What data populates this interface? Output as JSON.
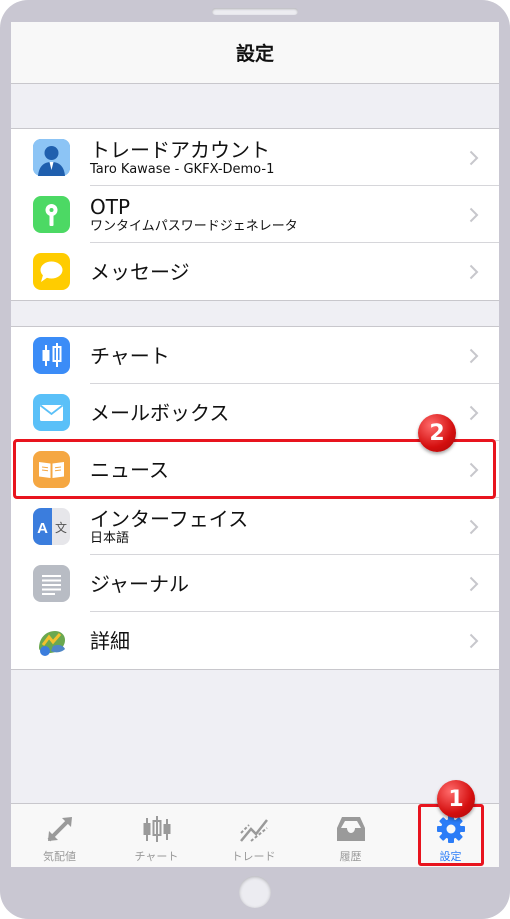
{
  "nav": {
    "title": "設定"
  },
  "groups": [
    {
      "items": [
        {
          "title": "トレードアカウント",
          "subtitle": "Taro Kawase - GKFX-Demo-1",
          "icon": "person-icon",
          "color": "#5ba8f0"
        },
        {
          "title": "OTP",
          "subtitle": "ワンタイムパスワードジェネレータ",
          "icon": "key-icon",
          "color": "#4cd964"
        },
        {
          "title": "メッセージ",
          "icon": "speech-bubble-icon",
          "color": "#ffcc00"
        }
      ]
    },
    {
      "items": [
        {
          "title": "チャート",
          "icon": "candlestick-icon",
          "color": "#3b8cf7"
        },
        {
          "title": "メールボックス",
          "icon": "envelope-icon",
          "color": "#5ac0f8"
        },
        {
          "title": "ニュース",
          "icon": "book-icon",
          "color": "#f5a742"
        },
        {
          "title": "インターフェイス",
          "subtitle": "日本語",
          "icon": "translate-icon",
          "color": "#3b7ddd"
        },
        {
          "title": "ジャーナル",
          "icon": "document-lines-icon",
          "color": "#b8bcc4"
        },
        {
          "title": "詳細",
          "icon": "metatrader-icon",
          "color": "#6aa84f"
        }
      ]
    }
  ],
  "annotations": {
    "badge_1": "1",
    "badge_2": "2"
  },
  "tabs": [
    {
      "label": "気配値",
      "icon": "quotes-arrows-icon",
      "active": false
    },
    {
      "label": "チャート",
      "icon": "candlestick-icon",
      "active": false
    },
    {
      "label": "トレード",
      "icon": "trade-chart-icon",
      "active": false
    },
    {
      "label": "履歴",
      "icon": "inbox-tray-icon",
      "active": false
    },
    {
      "label": "設定",
      "icon": "gear-icon",
      "active": true
    }
  ],
  "colors": {
    "accent": "#2b7cf7",
    "highlight": "#e8141e",
    "inactive_tab": "#9a9a9a"
  }
}
